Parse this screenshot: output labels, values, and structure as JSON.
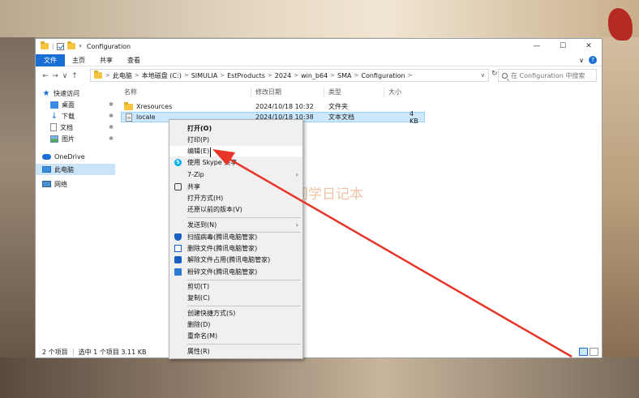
{
  "window": {
    "title": "Configuration",
    "controls": {
      "minimize": "—",
      "maximize": "☐",
      "close": "✕"
    }
  },
  "ribbon": {
    "tabs": [
      "文件",
      "主页",
      "共享",
      "查看"
    ],
    "expand": "∨",
    "help": "?"
  },
  "nav": {
    "back": "←",
    "forward": "→",
    "recent": "∨",
    "up": "↑",
    "refresh": "↻"
  },
  "address": {
    "crumbs": [
      "此电脑",
      "本地磁盘 (C:)",
      "SIMULIA",
      "EstProducts",
      "2024",
      "win_b64",
      "SMA",
      "Configuration"
    ],
    "separator": ">",
    "dropdown": "∨"
  },
  "search": {
    "placeholder": "在 Configuration 中搜索"
  },
  "sidebar": {
    "items": [
      {
        "label": "快速访问",
        "icon": "star-icon"
      },
      {
        "label": "桌面",
        "icon": "desktop-icon",
        "pinned": true
      },
      {
        "label": "下载",
        "icon": "download-icon",
        "pinned": true
      },
      {
        "label": "文档",
        "icon": "document-icon",
        "pinned": true
      },
      {
        "label": "图片",
        "icon": "picture-icon",
        "pinned": true
      },
      {
        "label": "OneDrive",
        "icon": "cloud-icon"
      },
      {
        "label": "此电脑",
        "icon": "computer-icon"
      },
      {
        "label": "网络",
        "icon": "network-icon"
      }
    ],
    "pin_glyph": "📌"
  },
  "columns": {
    "name": "名称",
    "modified": "修改日期",
    "type": "类型",
    "size": "大小"
  },
  "files": [
    {
      "name": "Xresources",
      "modified": "2024/10/18 10:32",
      "type": "文件夹",
      "size": "",
      "kind": "folder"
    },
    {
      "name": "locale",
      "modified": "2024/10/18 10:38",
      "type": "文本文档",
      "size": "4 KB",
      "kind": "file"
    }
  ],
  "status": {
    "count": "2 个项目",
    "selected": "选中 1 个项目  3.11 KB"
  },
  "context_menu": {
    "items": [
      {
        "label": "打开(O)",
        "bold": true
      },
      {
        "label": "打印(P)"
      },
      {
        "label": "编辑(E)",
        "hover": true
      },
      {
        "label": "使用 Skype 共享",
        "icon": "skype-icon"
      },
      {
        "label": "7-Zip",
        "submenu": true
      },
      {
        "label": "共享",
        "icon": "share-icon"
      },
      {
        "label": "打开方式(H)"
      },
      {
        "label": "还原以前的版本(V)"
      },
      {
        "sep": true
      },
      {
        "label": "发送到(N)",
        "submenu": true
      },
      {
        "sep": true
      },
      {
        "label": "扫描病毒(腾讯电脑管家)",
        "icon": "shield-icon"
      },
      {
        "label": "删除文件(腾讯电脑管家)",
        "icon": "delete-icon"
      },
      {
        "label": "解除文件占用(腾讯电脑管家)",
        "icon": "unlock-icon"
      },
      {
        "label": "粉碎文件(腾讯电脑管家)",
        "icon": "shred-icon"
      },
      {
        "sep": true
      },
      {
        "label": "剪切(T)"
      },
      {
        "label": "复制(C)"
      },
      {
        "sep": true
      },
      {
        "label": "创建快捷方式(S)"
      },
      {
        "label": "删除(D)"
      },
      {
        "label": "重命名(M)"
      },
      {
        "sep": true
      },
      {
        "label": "属性(R)"
      }
    ],
    "submenu_glyph": "›"
  },
  "watermark": {
    "text": "不同学日记本"
  },
  "colors": {
    "accent": "#1a6fd6",
    "selection": "#cce8ff",
    "annotation_arrow": "#e8352a"
  }
}
